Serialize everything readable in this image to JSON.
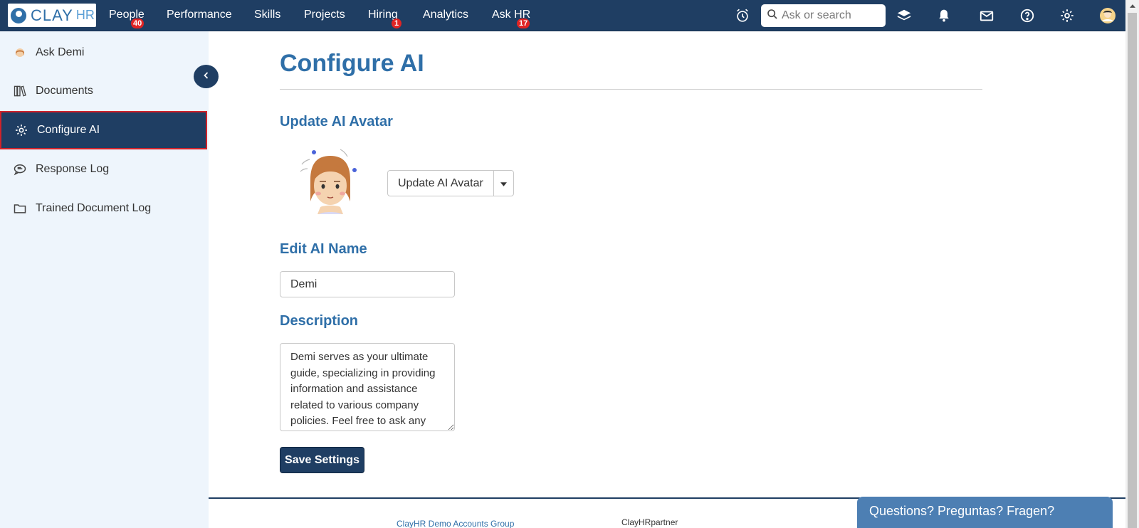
{
  "app": {
    "logo_text": "CLAY",
    "logo_suffix": "HR"
  },
  "nav": {
    "items": [
      {
        "label": "People",
        "badge": "40"
      },
      {
        "label": "Performance",
        "badge": ""
      },
      {
        "label": "Skills",
        "badge": ""
      },
      {
        "label": "Projects",
        "badge": ""
      },
      {
        "label": "Hiring",
        "badge": "1"
      },
      {
        "label": "Analytics",
        "badge": ""
      },
      {
        "label": "Ask HR",
        "badge": "17"
      }
    ],
    "search_placeholder": "Ask or search",
    "icons": [
      "alarm-clock-icon",
      "search-icon",
      "layers-icon",
      "bell-icon",
      "mail-icon",
      "help-icon",
      "gear-icon",
      "user-avatar-icon"
    ]
  },
  "sidebar": {
    "items": [
      {
        "label": "Ask Demi",
        "icon": "demi-avatar-icon"
      },
      {
        "label": "Documents",
        "icon": "books-icon"
      },
      {
        "label": "Configure AI",
        "icon": "gear-icon",
        "active": true
      },
      {
        "label": "Response Log",
        "icon": "chat-bubble-icon"
      },
      {
        "label": "Trained Document Log",
        "icon": "folder-icon"
      }
    ]
  },
  "main": {
    "title": "Configure AI",
    "avatar_section_title": "Update AI Avatar",
    "avatar_button_label": "Update AI Avatar",
    "name_section_title": "Edit AI Name",
    "name_value": "Demi",
    "description_section_title": "Description",
    "description_value": "Demi serves as your ultimate guide, specializing in providing information and assistance related to various company policies. Feel free to ask any",
    "save_label": "Save Settings"
  },
  "footer": {
    "link_text": "ClayHR Demo Accounts Group",
    "partner_text": "ClayHRpartner",
    "chat_label": "Questions? Preguntas? Fragen?"
  },
  "colors": {
    "primary": "#1f3e63",
    "accent": "#2f6fa8",
    "badge": "#e02424",
    "active_outline": "#d0222a",
    "sidebar_bg": "#eef5fc",
    "chat_bg": "#4d7fb3"
  }
}
